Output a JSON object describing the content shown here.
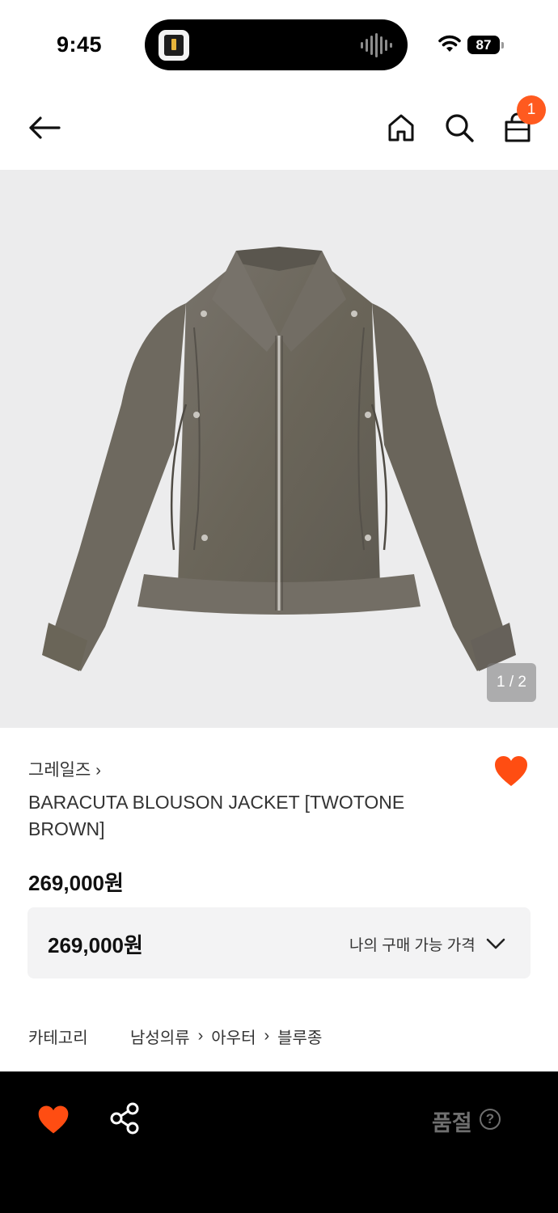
{
  "status_bar": {
    "time": "9:45",
    "battery": "87"
  },
  "header": {
    "cart_count": "1"
  },
  "product": {
    "image_counter": "1 / 2",
    "brand": "그레일즈",
    "name": "BARACUTA BLOUSON JACKET [TWOTONE BROWN]",
    "price": "269,000원",
    "my_price_value": "269,000원",
    "my_price_label": "나의 구매 가능 가격",
    "category_label": "카테고리",
    "categories": [
      "남성의류",
      "아우터",
      "블루종"
    ]
  },
  "bottom_bar": {
    "status": "품절",
    "help": "?"
  },
  "colors": {
    "accent": "#ff5a1f",
    "jacket": "#6b665c",
    "image_bg": "#ececed"
  },
  "icons": [
    "back-arrow-icon",
    "home-icon",
    "search-icon",
    "shopping-bag-icon",
    "heart-icon",
    "share-icon",
    "chevron-down-icon",
    "help-icon"
  ]
}
